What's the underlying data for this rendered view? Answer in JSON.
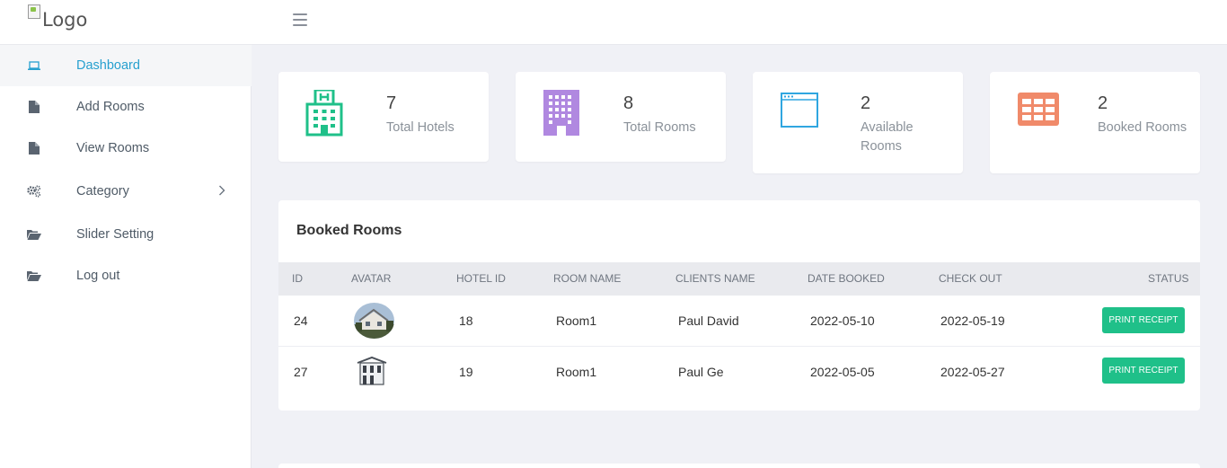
{
  "header": {
    "logo_alt": "Logo",
    "menu_icon": "hamburger-icon"
  },
  "sidebar": {
    "items": [
      {
        "label": "Dashboard",
        "icon": "laptop-icon",
        "active": true
      },
      {
        "label": "Add Rooms",
        "icon": "file-icon"
      },
      {
        "label": "View Rooms",
        "icon": "file-icon"
      },
      {
        "label": "Category",
        "icon": "gears-icon",
        "has_submenu": true
      },
      {
        "label": "Slider Setting",
        "icon": "folder-open-icon"
      },
      {
        "label": "Log out",
        "icon": "folder-open-icon"
      }
    ]
  },
  "stats": [
    {
      "value": "7",
      "label": "Total Hotels",
      "icon": "hotel-icon",
      "color": "#1fc089"
    },
    {
      "value": "8",
      "label": "Total Rooms",
      "icon": "building-icon",
      "color": "#b088e0"
    },
    {
      "value": "2",
      "label": "Available Rooms",
      "icon": "window-icon",
      "color": "#2fa6e0"
    },
    {
      "value": "2",
      "label": "Booked Rooms",
      "icon": "table-icon",
      "color": "#f08a6a"
    }
  ],
  "booked": {
    "title": "Booked Rooms",
    "columns": [
      "ID",
      "AVATAR",
      "HOTEL ID",
      "ROOM NAME",
      "CLIENTS NAME",
      "DATE BOOKED",
      "CHECK OUT",
      "STATUS"
    ],
    "rows": [
      {
        "id": "24",
        "hotel_id": "18",
        "room_name": "Room1",
        "client": "Paul David",
        "date_booked": "2022-05-10",
        "check_out": "2022-05-19",
        "action": "PRINT RECEIPT"
      },
      {
        "id": "27",
        "hotel_id": "19",
        "room_name": "Room1",
        "client": "Paul Ge",
        "date_booked": "2022-05-05",
        "check_out": "2022-05-27",
        "action": "PRINT RECEIPT"
      }
    ]
  },
  "colors": {
    "accent": "#27a0cf",
    "button": "#1fc089"
  }
}
